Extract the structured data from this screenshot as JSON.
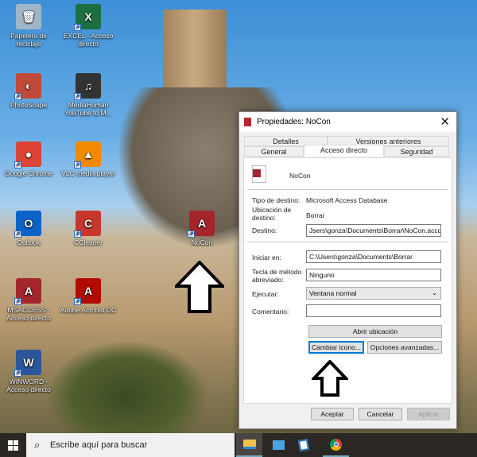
{
  "desktop": {
    "icons": [
      {
        "label": "Papelera de reciclaje",
        "glyph": "🗑",
        "color": "#9fb6c9"
      },
      {
        "label": "EXCEL - Acceso directo",
        "glyph": "X",
        "color": "#1d6f42"
      },
      {
        "label": "PhotoScape",
        "glyph": "◐",
        "color": "#c04a3a"
      },
      {
        "label": "MediaHuman YouTube to M...",
        "glyph": "♫",
        "color": "#333"
      },
      {
        "label": "Google Chrome",
        "glyph": "●",
        "color": "#db4437"
      },
      {
        "label": "VLC media player",
        "glyph": "▲",
        "color": "#f08a00"
      },
      {
        "label": "Outlook",
        "glyph": "O",
        "color": "#0a64c8"
      },
      {
        "label": "CCleaner",
        "glyph": "C",
        "color": "#c8372d"
      },
      {
        "label": "MSACCESS - Acceso directo",
        "glyph": "A",
        "color": "#a4262c"
      },
      {
        "label": "Adobe Acrobat DC",
        "glyph": "A",
        "color": "#b30b00"
      },
      {
        "label": "WINWORD - Acceso directo",
        "glyph": "W",
        "color": "#2b579a"
      },
      {
        "label": "NoCon",
        "glyph": "A",
        "color": "#a4262c"
      }
    ]
  },
  "dialog": {
    "title": "Propiedades: NoCon",
    "tabs": {
      "row1": [
        "Detalles",
        "Versiones anteriores"
      ],
      "row2": [
        "General",
        "Acceso directo",
        "Seguridad"
      ]
    },
    "name": "NoCon",
    "fields": {
      "tipo_label": "Tipo de destino:",
      "tipo_value": "Microsoft Access Database",
      "ubicacion_label": "Ubicación de destino:",
      "ubicacion_value": "Borrar",
      "destino_label": "Destino:",
      "destino_value": "Jsers\\gonza\\Documents\\Borrar\\NoCon.accdb",
      "iniciar_label": "Iniciar en:",
      "iniciar_value": "C:\\Users\\gonza\\Documents\\Borrar",
      "tecla_label": "Tecla de método abreviado:",
      "tecla_value": "Ninguno",
      "ejecutar_label": "Ejecutar:",
      "ejecutar_value": "Ventana normal",
      "comentario_label": "Comentario:",
      "comentario_value": ""
    },
    "buttons": {
      "abrir": "Abrir ubicación",
      "cambiar": "Cambiar icono...",
      "opciones": "Opciones avanzadas...",
      "aceptar": "Aceptar",
      "cancelar": "Cancelar",
      "aplicar": "Aplicar"
    }
  },
  "taskbar": {
    "search_placeholder": "Escribe aquí para buscar"
  }
}
